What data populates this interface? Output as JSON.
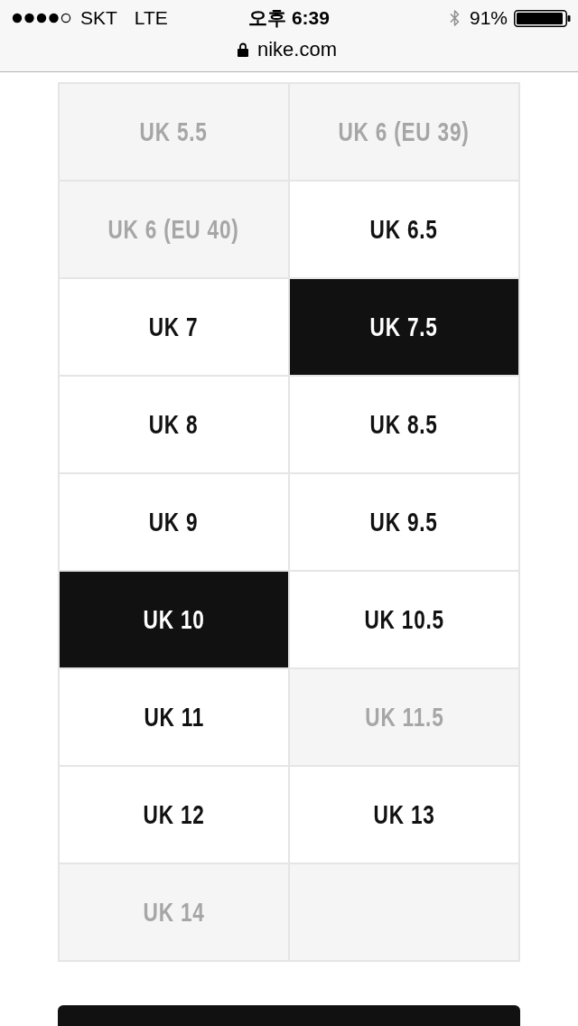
{
  "status_bar": {
    "carrier": "SKT",
    "network": "LTE",
    "time": "오후 6:39",
    "battery": "91%"
  },
  "address_bar": {
    "url": "nike.com"
  },
  "sizes": [
    {
      "label": "UK 5.5",
      "disabled": true,
      "selected": false
    },
    {
      "label": "UK 6 (EU 39)",
      "disabled": true,
      "selected": false
    },
    {
      "label": "UK 6 (EU 40)",
      "disabled": true,
      "selected": false
    },
    {
      "label": "UK 6.5",
      "disabled": false,
      "selected": false
    },
    {
      "label": "UK 7",
      "disabled": false,
      "selected": false
    },
    {
      "label": "UK 7.5",
      "disabled": false,
      "selected": true
    },
    {
      "label": "UK 8",
      "disabled": false,
      "selected": false
    },
    {
      "label": "UK 8.5",
      "disabled": false,
      "selected": false
    },
    {
      "label": "UK 9",
      "disabled": false,
      "selected": false
    },
    {
      "label": "UK 9.5",
      "disabled": false,
      "selected": false
    },
    {
      "label": "UK 10",
      "disabled": false,
      "selected": true
    },
    {
      "label": "UK 10.5",
      "disabled": false,
      "selected": false
    },
    {
      "label": "UK 11",
      "disabled": false,
      "selected": false
    },
    {
      "label": "UK 11.5",
      "disabled": true,
      "selected": false
    },
    {
      "label": "UK 12",
      "disabled": false,
      "selected": false
    },
    {
      "label": "UK 13",
      "disabled": false,
      "selected": false
    },
    {
      "label": "UK 14",
      "disabled": true,
      "selected": false
    }
  ]
}
